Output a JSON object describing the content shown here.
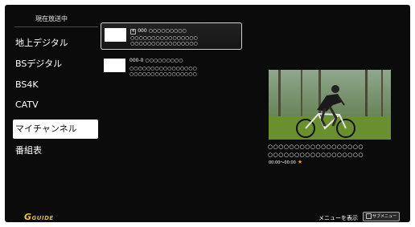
{
  "header": {
    "label": "現在放送中"
  },
  "sidebar": {
    "items": [
      {
        "label": "地上デジタル"
      },
      {
        "label": "BSデジタル"
      },
      {
        "label": "BS4K"
      },
      {
        "label": "CATV"
      },
      {
        "label": "マイチャンネル",
        "selected": true
      },
      {
        "label": "番組表"
      }
    ]
  },
  "channels": [
    {
      "badge": "4",
      "number": "000",
      "name": "○○○○○○○○○",
      "program_line1": "○○○○○○○○○○○○○○○○",
      "program_line2": "○○○○○○○○○○○○○○○○",
      "selected": true
    },
    {
      "number": "000-0",
      "name": "○○○○○○○○○",
      "program_line1": "○○○○○○○○○○○○○○○○",
      "program_line2": "○○○○○○○○○○○○○○○○",
      "selected": false
    }
  ],
  "program": {
    "title_line1": "○○○○○○○○○○○○○○○○○○",
    "title_line2": "○○○○○○○○○○○○○○○○○○",
    "time": "00:00〜00:00"
  },
  "footer": {
    "logo": "GUIDE",
    "menu_hint": "メニューを表示",
    "sub_menu_label": "サブメニュー"
  },
  "colors": {
    "background": "#0b0b0b",
    "selected_bg": "#ffffff",
    "star": "#f0a020",
    "logo": "#d8b93a"
  }
}
